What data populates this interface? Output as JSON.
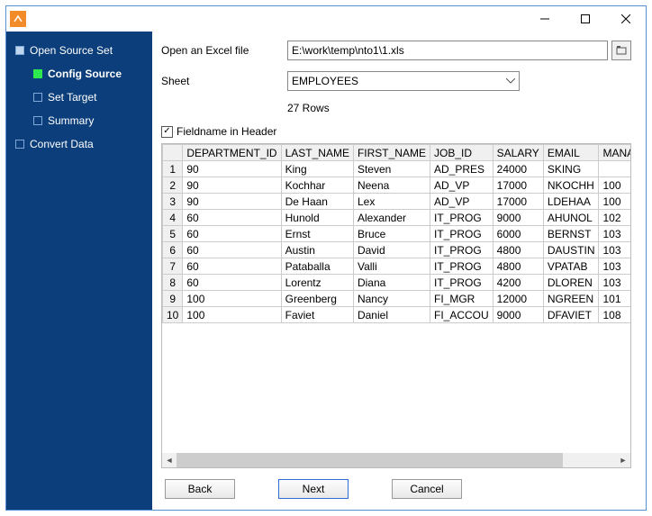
{
  "sidebar": {
    "items": [
      {
        "label": "Open Source Set",
        "active": false,
        "child": false
      },
      {
        "label": "Config Source",
        "active": true,
        "child": true
      },
      {
        "label": "Set Target",
        "active": false,
        "child": true
      },
      {
        "label": "Summary",
        "active": false,
        "child": true
      },
      {
        "label": "Convert Data",
        "active": false,
        "child": false
      }
    ]
  },
  "form": {
    "file_label": "Open an Excel file",
    "file_value": "E:\\work\\temp\\nto1\\1.xls",
    "sheet_label": "Sheet",
    "sheet_value": "EMPLOYEES",
    "rows_text": "27 Rows",
    "fieldname_label": "Fieldname in Header",
    "fieldname_checked": true
  },
  "grid": {
    "columns": [
      "DEPARTMENT_ID",
      "LAST_NAME",
      "FIRST_NAME",
      "JOB_ID",
      "SALARY",
      "EMAIL",
      "MANAGER_ID"
    ],
    "rows": [
      [
        "90",
        "King",
        "Steven",
        "AD_PRES",
        "24000",
        "SKING",
        ""
      ],
      [
        "90",
        "Kochhar",
        "Neena",
        "AD_VP",
        "17000",
        "NKOCHH",
        "100"
      ],
      [
        "90",
        "De Haan",
        "Lex",
        "AD_VP",
        "17000",
        "LDEHAA",
        "100"
      ],
      [
        "60",
        "Hunold",
        "Alexander",
        "IT_PROG",
        "9000",
        "AHUNOL",
        "102"
      ],
      [
        "60",
        "Ernst",
        "Bruce",
        "IT_PROG",
        "6000",
        "BERNST",
        "103"
      ],
      [
        "60",
        "Austin",
        "David",
        "IT_PROG",
        "4800",
        "DAUSTIN",
        "103"
      ],
      [
        "60",
        "Pataballa",
        "Valli",
        "IT_PROG",
        "4800",
        "VPATAB",
        "103"
      ],
      [
        "60",
        "Lorentz",
        "Diana",
        "IT_PROG",
        "4200",
        "DLOREN",
        "103"
      ],
      [
        "100",
        "Greenberg",
        "Nancy",
        "FI_MGR",
        "12000",
        "NGREEN",
        "101"
      ],
      [
        "100",
        "Faviet",
        "Daniel",
        "FI_ACCOU",
        "9000",
        "DFAVIET",
        "108"
      ]
    ]
  },
  "buttons": {
    "back": "Back",
    "next": "Next",
    "cancel": "Cancel"
  }
}
